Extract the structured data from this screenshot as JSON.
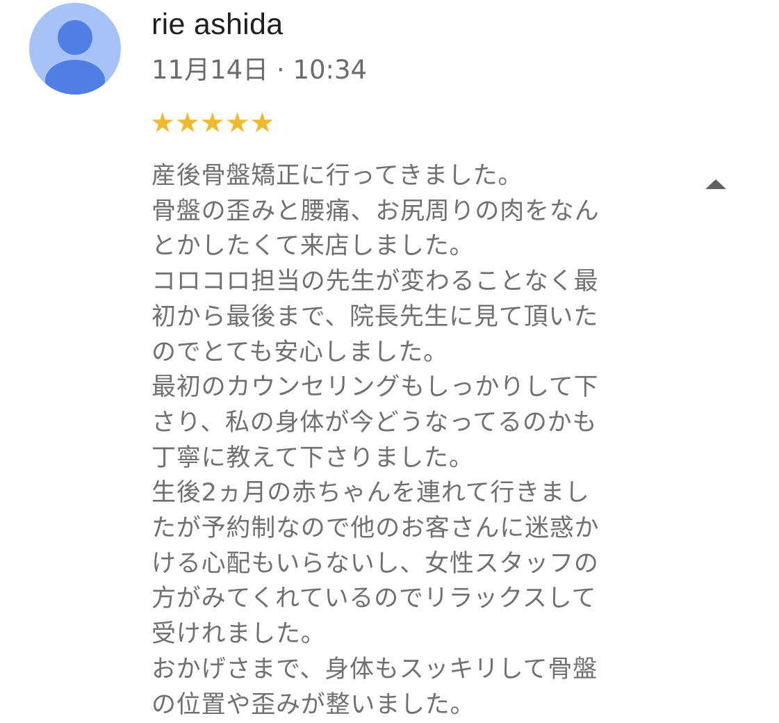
{
  "review": {
    "reviewer_name": "rie ashida",
    "date": "11月14日 · 10:34",
    "rating": 5,
    "stars": [
      "★",
      "★",
      "★",
      "★",
      "★"
    ],
    "lines": [
      "産後骨盤矯正に行ってきました。",
      "骨盤の歪みと腰痛、お尻周りの肉をなん",
      "とかしたくて来店しました。",
      "コロコロ担当の先生が変わることなく最",
      "初から最後まで、院長先生に見て頂いた",
      "のでとても安心しました。",
      "最初のカウンセリングもしっかりして下",
      "さり、私の身体が今どうなってるのかも",
      "丁寧に教えて下さりました。",
      "生後2ヵ月の赤ちゃんを連れて行きまし",
      "たが予約制なので他のお客さんに迷惑か",
      "ける心配もいらないし、女性スタッフの",
      "方がみてくれているのでリラックスして",
      "受けれました。",
      "おかげさまで、身体もスッキリして骨盤",
      "の位置や歪みが整いました。"
    ]
  },
  "icons": {
    "avatar": "default-person-avatar-icon",
    "collapse": "triangle-up-icon",
    "star": "star-icon"
  },
  "colors": {
    "star": "#f2b92f",
    "avatar_bg": "#a7c2f7",
    "avatar_figure": "#4f7fe0",
    "body_text": "#707070",
    "name_text": "#1f1f1f"
  }
}
